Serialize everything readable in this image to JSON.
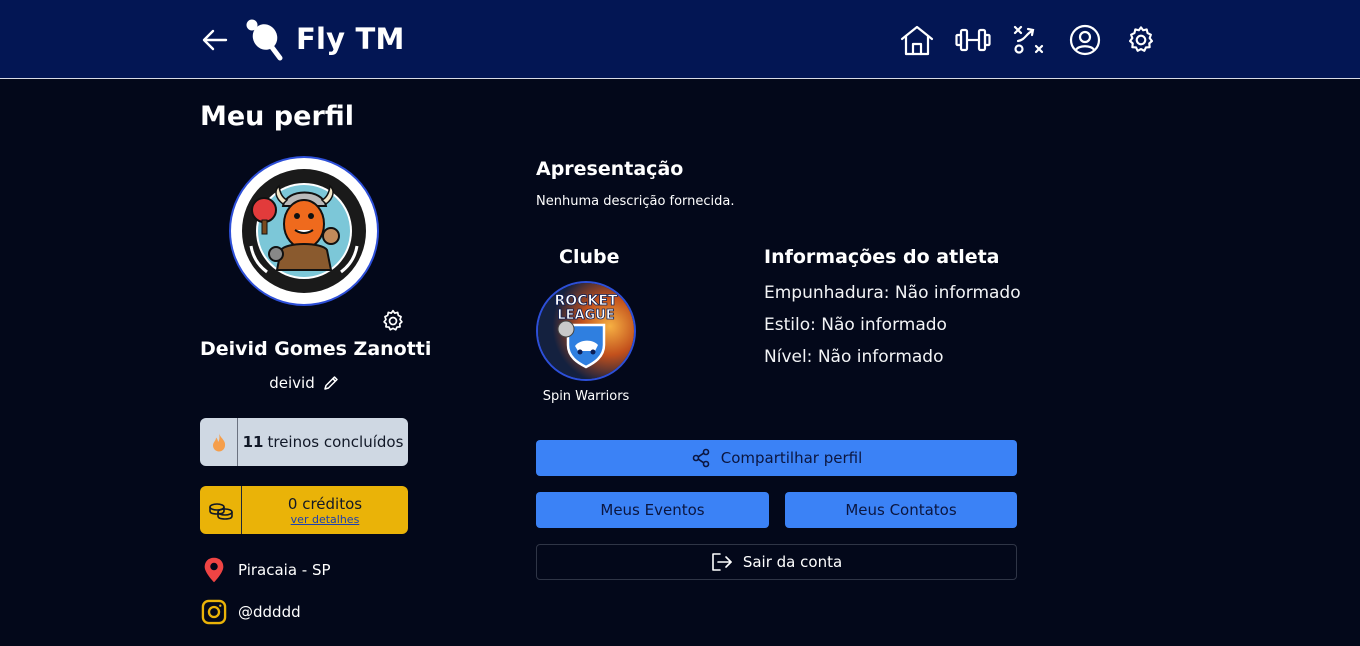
{
  "app": {
    "title": "Fly TM"
  },
  "nav": {
    "back_icon": "arrow-left-icon",
    "logo_icon": "ping-pong-paddle-icon",
    "items": [
      {
        "icon": "home-icon"
      },
      {
        "icon": "dumbbell-icon"
      },
      {
        "icon": "tactics-board-icon"
      },
      {
        "icon": "user-circle-icon"
      },
      {
        "icon": "gear-icon"
      }
    ]
  },
  "page": {
    "title": "Meu perfil"
  },
  "profile": {
    "avatar_icon": "club-badge-avatar",
    "name": "Deivid Gomes Zanotti",
    "username": "deivid",
    "trainings_count": "11",
    "trainings_label": "treinos concluídos",
    "credits_label": "0 créditos",
    "credits_link": "ver detalhes",
    "location": "Piracaia - SP",
    "instagram": "@ddddd"
  },
  "presentation": {
    "title": "Apresentação",
    "text": "Nenhuma descrição fornecida."
  },
  "club": {
    "title": "Clube",
    "name": "Spin Warriors",
    "logo_text_line1": "ROCKET",
    "logo_text_line2": "LEAGUE"
  },
  "athlete": {
    "title": "Informações do atleta",
    "grip": "Empunhadura: Não informado",
    "style": "Estilo: Não informado",
    "level": "Nível: Não informado"
  },
  "actions": {
    "share": "Compartilhar perfil",
    "events": "Meus Eventos",
    "contacts": "Meus Contatos",
    "logout": "Sair da conta"
  },
  "colors": {
    "topbar": "#031654",
    "background": "#03081a",
    "primary_button": "#3b82f6",
    "credits_card": "#eab308",
    "trainings_card": "#cfd8e3",
    "location_pin": "#ef4444"
  }
}
